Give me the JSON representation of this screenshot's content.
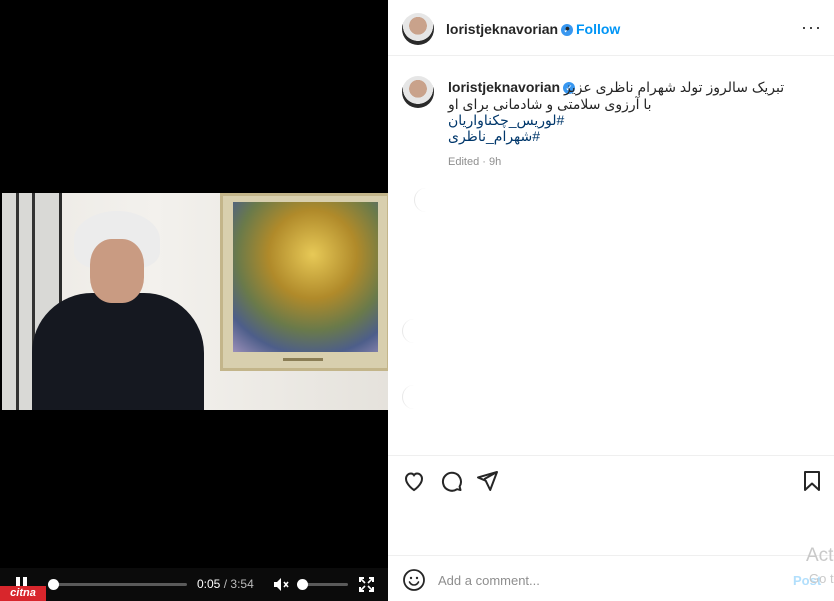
{
  "video": {
    "current_time": "0:05",
    "separator": "/",
    "total_time": "3:54",
    "progress_fraction": 0.02,
    "volume_fraction": 0.05,
    "watermark": "citna"
  },
  "header": {
    "username": "loristjeknavorian",
    "verified_glyph": "✓",
    "dot": "•",
    "follow_label": "Follow",
    "more_glyph": "···"
  },
  "caption": {
    "username": "loristjeknavorian",
    "line1": "تبریک سالروز تولد شهرام ناظری عزیز",
    "line2": "با آرزوی سلامتی و شادمانی برای او",
    "hashtag1": "#لوریس_چکناواریان",
    "hashtag2": "#شهرام_ناظری",
    "meta": "Edited · 9h"
  },
  "actions": {
    "like_icon": "heart-icon",
    "comment_icon": "comment-icon",
    "share_icon": "paper-plane-icon",
    "save_icon": "bookmark-icon"
  },
  "comment_bar": {
    "placeholder": "Add a comment...",
    "post_label": "Post"
  },
  "os_watermark": {
    "line1": "Act",
    "line2": "Go t"
  },
  "colors": {
    "accent": "#0095f6",
    "hashtag": "#00376b",
    "verified": "#3897f0",
    "watermark_red": "#d8262c"
  }
}
